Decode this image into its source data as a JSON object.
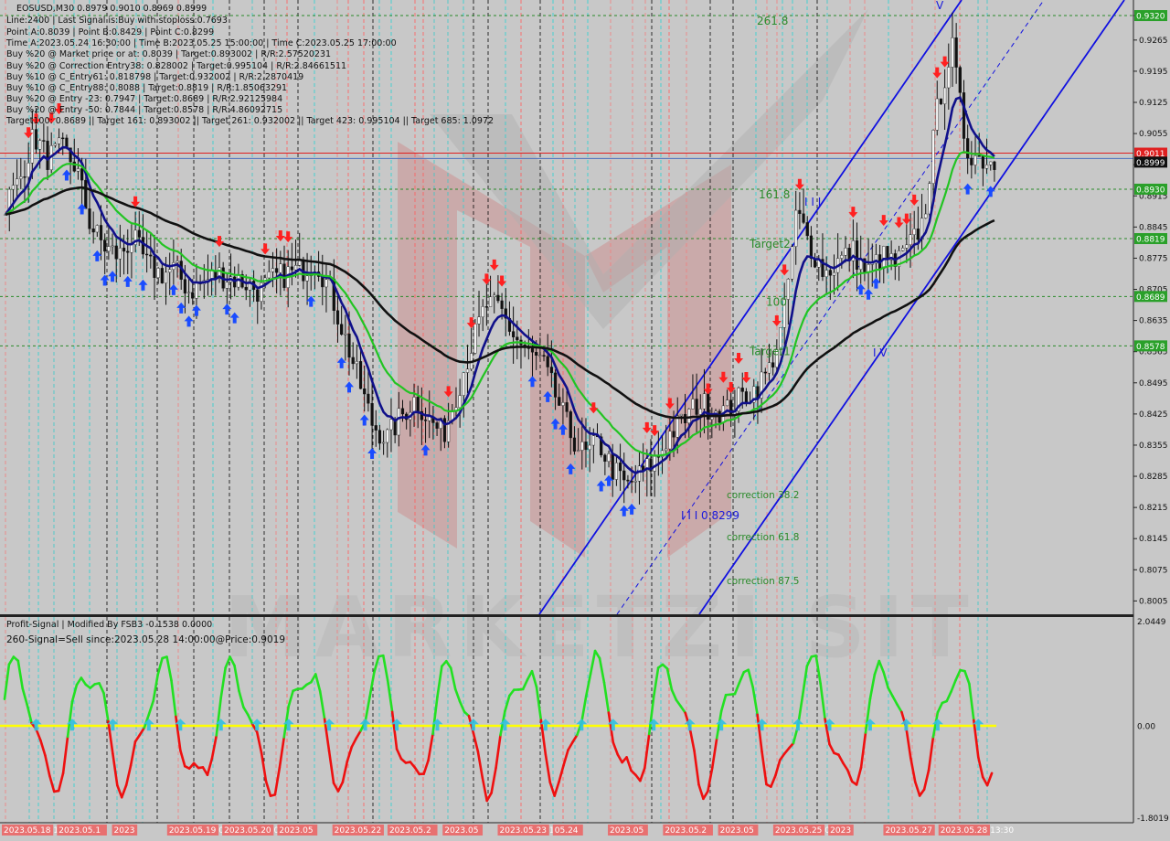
{
  "header": {
    "symbol_line": "EOSUSD,M30  0.8979 0.9010 0.8969 0.8999",
    "info_lines": [
      "Line:2400 | Last Signal is:Buy with stoploss:0.7693",
      "Point A:0.8039 | Point B:0.8429 | Point C:0.8299",
      "Time A:2023.05.24 16:30:00 | Time B:2023.05.25 15:00:00 | Time C:2023.05.25 17:00:00",
      "Buy %20 @ Market price or at: 0.8039 | Target:0.893002 | R/R:2.57520231",
      "Buy %20 @ Correction Entry38: 0.828002 | Target:0.995104 | R/R:2.84661511",
      "Buy %10 @ C_Entry61: 0.818798 | Target:0.932002 | R/R:2.2870419",
      "Buy %10 @ C_Entry88: 0.8088 | Target:0.8819 | R/R:1.85063291",
      "Buy %20 @ Entry -23: 0.7947 | Target:0.8689 | R/R:2.92125984",
      "Buy %20 @ Entry -50: 0.7844 | Target:0.8578 | R/R:4.86092715",
      "Target100: 0.8689 || Target 161: 0.893002 || Target 261: 0.932002 || Target 423: 0.995104 || Target 685: 1.0972"
    ]
  },
  "price_axis": {
    "ticks": [
      "0.9320",
      "0.9265",
      "0.9195",
      "0.9125",
      "0.9055",
      "0.8985",
      "0.8915",
      "0.8845",
      "0.8775",
      "0.8705",
      "0.8635",
      "0.8565",
      "0.8495",
      "0.8425",
      "0.8355",
      "0.8285",
      "0.8215",
      "0.8145",
      "0.8075",
      "0.8005"
    ],
    "current_price": "0.8999",
    "red_line_price": "0.9011",
    "level_badges": [
      {
        "price": "0.9320",
        "label": "261.8"
      },
      {
        "price": "0.8930",
        "label": "161.8"
      },
      {
        "price": "0.8819",
        "label": "Target2"
      },
      {
        "price": "0.8689",
        "label": "100"
      },
      {
        "price": "0.8578",
        "label": "Target1"
      }
    ]
  },
  "annotations": {
    "correction_labels": [
      "correction 38.2",
      "correction 61.8",
      "correction 87.5"
    ],
    "wave_label_c": "I I I 0.8299",
    "wave_label_iii": "I I I",
    "wave_label_v": "V",
    "wave_label_iv": "I V"
  },
  "watermark": "MARKETZI SIT",
  "indicator": {
    "title": "Profit-Signal | Modified By FSB3 -0.1538 0.0000",
    "signal_line": "260-Signal=Sell since:2023.05.28 14:00:00@Price:0.9019",
    "axis_ticks": [
      "2.0449",
      "0.00",
      "-1.8019"
    ]
  },
  "date_axis": {
    "labels": [
      "2023.05.18 18:00",
      "2023.05.1",
      "2023",
      "2023.05.19 09:00",
      "2023.05.20 05:00",
      "2023.05",
      "2023.05.22",
      "2023.05.2",
      "2023.05",
      "2023.05.23 14:00",
      "05.24",
      "2023.05",
      "2023.05.2",
      "2023.05",
      "2023.05.25 05:30",
      "2023",
      "2023.05.27",
      "2023.05.28 13:30"
    ]
  },
  "chart_data": {
    "type": "candlestick",
    "symbol": "EOSUSD",
    "timeframe": "M30",
    "ohlc_last": {
      "open": 0.8979,
      "high": 0.901,
      "low": 0.8969,
      "close": 0.8999
    },
    "ylim": [
      0.7975,
      0.9355
    ],
    "levels": [
      {
        "name": "261.8",
        "value": 0.932
      },
      {
        "name": "161.8",
        "value": 0.893
      },
      {
        "name": "Target2",
        "value": 0.8819
      },
      {
        "name": "100",
        "value": 0.8689
      },
      {
        "name": "Target1",
        "value": 0.8578
      }
    ],
    "bid": 0.8999,
    "series": [
      {
        "name": "price",
        "values": [
          0.89,
          0.895,
          0.905,
          0.9,
          0.902,
          0.898,
          0.885,
          0.88,
          0.878,
          0.882,
          0.876,
          0.874,
          0.875,
          0.87,
          0.872,
          0.874,
          0.873,
          0.872,
          0.87,
          0.873,
          0.874,
          0.875,
          0.877,
          0.87,
          0.86,
          0.85,
          0.84,
          0.837,
          0.842,
          0.846,
          0.841,
          0.838,
          0.848,
          0.858,
          0.867,
          0.866,
          0.86,
          0.856,
          0.854,
          0.846,
          0.838,
          0.833,
          0.836,
          0.83,
          0.826,
          0.829,
          0.832,
          0.838,
          0.841,
          0.845,
          0.844,
          0.843,
          0.846,
          0.848,
          0.852,
          0.862,
          0.888,
          0.88,
          0.874,
          0.877,
          0.879,
          0.874,
          0.878,
          0.876,
          0.88,
          0.886,
          0.912,
          0.925,
          0.902,
          0.9,
          0.899
        ]
      }
    ],
    "indicator_ylim": [
      -1.8019,
      2.0449
    ]
  }
}
